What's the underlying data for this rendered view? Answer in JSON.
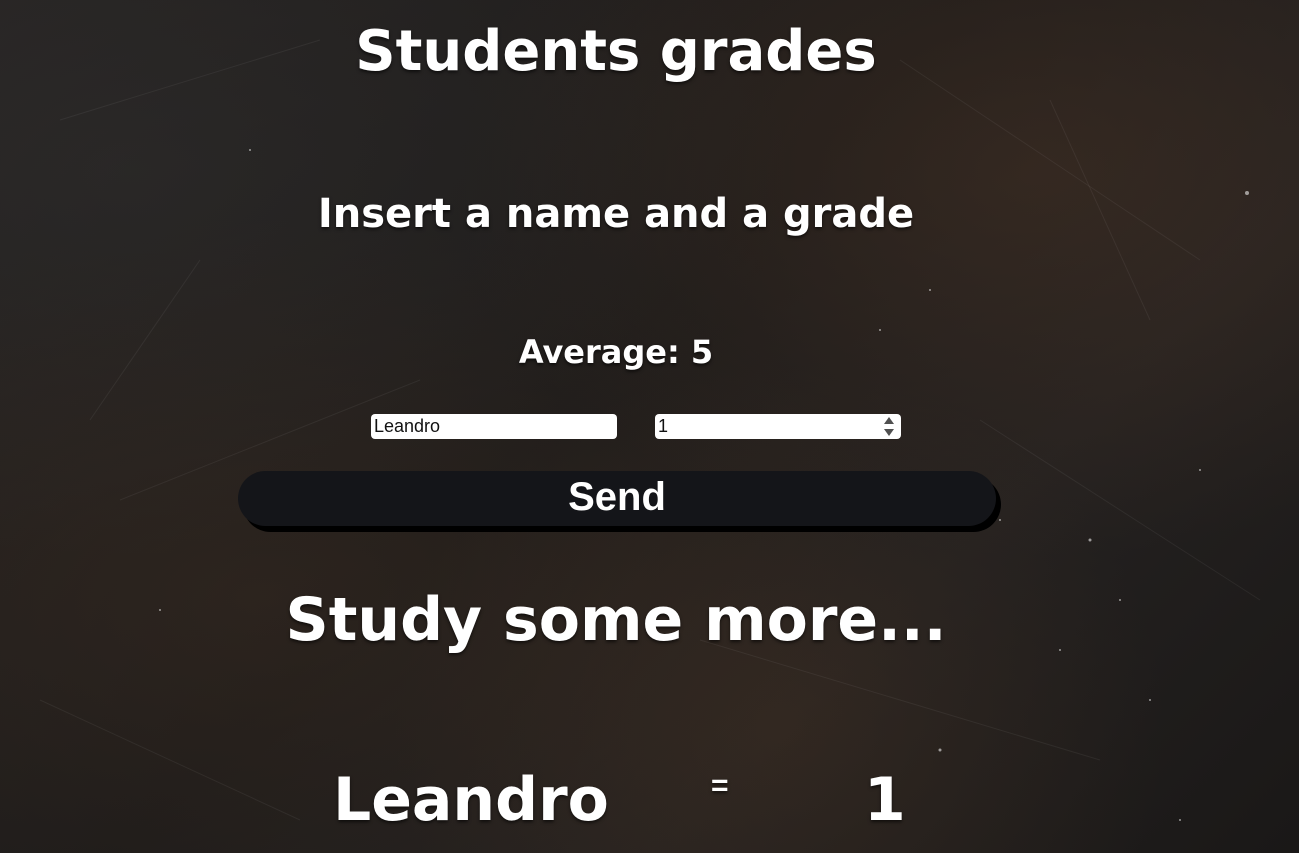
{
  "header": {
    "title": "Students grades",
    "subtitle": "Insert a name and a grade"
  },
  "average": {
    "label": "Average:",
    "value": "5"
  },
  "form": {
    "name_value": "Leandro",
    "grade_value": "1",
    "send_label": "Send"
  },
  "result": {
    "message": "Study some more...",
    "student_name": "Leandro",
    "separator": "=",
    "grade": "1"
  },
  "icons": {
    "spinner_up": "chevron-up-icon",
    "spinner_down": "chevron-down-icon"
  },
  "colors": {
    "text": "#ffffff",
    "button_bg": "#141519",
    "input_bg": "#ffffff"
  }
}
